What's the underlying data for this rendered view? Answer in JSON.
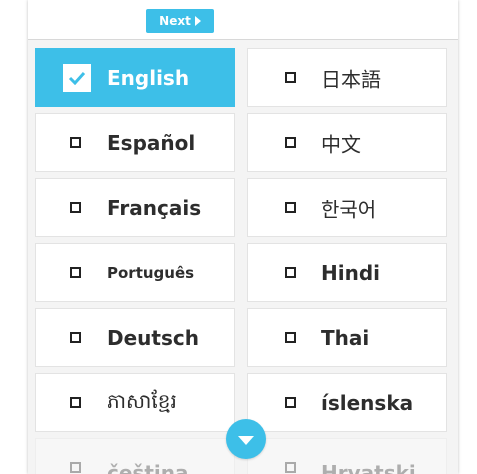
{
  "toolbar": {
    "next_label": "Next"
  },
  "languages": [
    {
      "label": "English",
      "checked": true
    },
    {
      "label": "日本語",
      "checked": false
    },
    {
      "label": "Español",
      "checked": false
    },
    {
      "label": "中文",
      "checked": false
    },
    {
      "label": "Français",
      "checked": false
    },
    {
      "label": "한국어",
      "checked": false
    },
    {
      "label": "Português",
      "checked": false
    },
    {
      "label": "Hindi",
      "checked": false
    },
    {
      "label": "Deutsch",
      "checked": false
    },
    {
      "label": "Thai",
      "checked": false
    },
    {
      "label": "ភាសាខ្មែរ",
      "checked": false
    },
    {
      "label": "íslenska",
      "checked": false
    },
    {
      "label": "čeština",
      "checked": false
    },
    {
      "label": "Hrvatski",
      "checked": false
    }
  ],
  "colors": {
    "accent": "#3dbfe8",
    "panel": "#f4f4f4",
    "text": "#2d2d2d"
  },
  "icons": {
    "next": "caret-right-icon",
    "scroll": "chevron-down-icon",
    "check": "checkmark-icon"
  }
}
